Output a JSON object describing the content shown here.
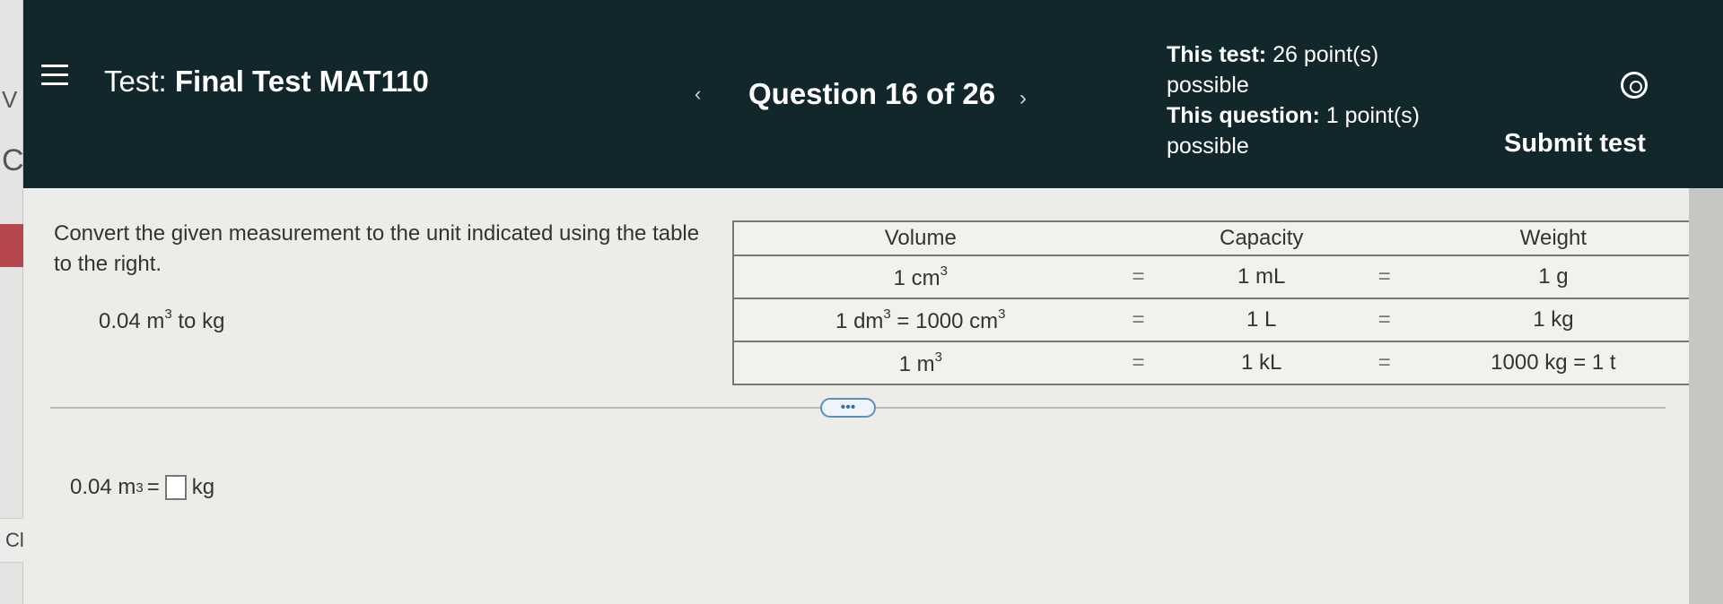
{
  "header": {
    "test_prefix": "Test:",
    "test_name": "Final Test MAT110",
    "question_label": "Question 16 of 26",
    "points_test_label": "This test:",
    "points_test_value": "26 point(s) possible",
    "points_question_label": "This question:",
    "points_question_value": "1 point(s) possible",
    "submit_label": "Submit test"
  },
  "sidebar": {
    "clear_label": "Cle"
  },
  "question": {
    "instructions": "Convert the given measurement to the unit indicated using the table to the right.",
    "problem_value": "0.04 m",
    "problem_exp": "3",
    "problem_unit": "to kg",
    "answer_prefix": "0.04 m",
    "answer_exp": "3",
    "answer_eq": "=",
    "answer_unit": "kg",
    "more_label": "•••"
  },
  "table": {
    "headers": {
      "volume": "Volume",
      "capacity": "Capacity",
      "weight": "Weight"
    },
    "rows": [
      {
        "vol_a": "1 cm",
        "vol_exp": "3",
        "vol_b": "",
        "vol_exp2": "",
        "eq1": "=",
        "capacity": "1 mL",
        "eq2": "=",
        "weight": "1 g"
      },
      {
        "vol_a": "1 dm",
        "vol_exp": "3",
        "vol_b": " = 1000 cm",
        "vol_exp2": "3",
        "eq1": "=",
        "capacity": "1 L",
        "eq2": "=",
        "weight": "1 kg"
      },
      {
        "vol_a": "1 m",
        "vol_exp": "3",
        "vol_b": "",
        "vol_exp2": "",
        "eq1": "=",
        "capacity": "1 kL",
        "eq2": "=",
        "weight": "1000 kg = 1 t"
      }
    ]
  }
}
